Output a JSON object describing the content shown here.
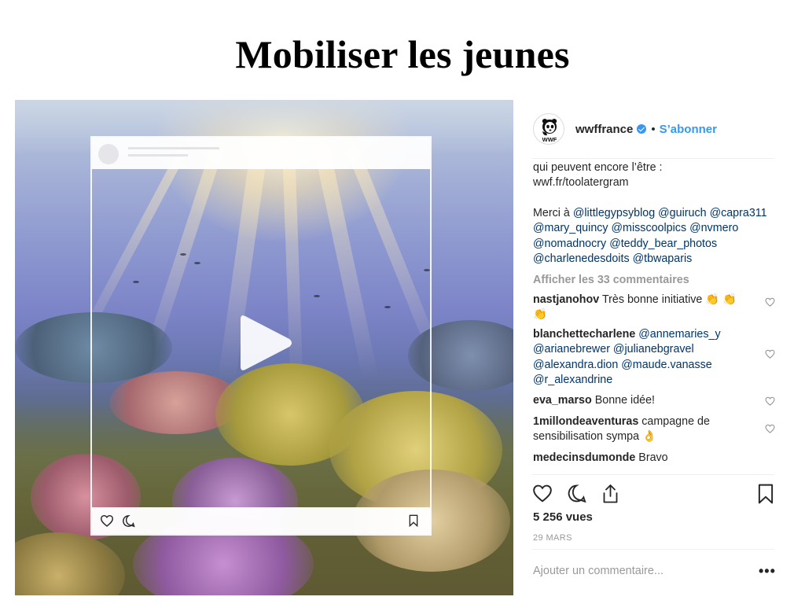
{
  "slide": {
    "title": "Mobiliser les jeunes"
  },
  "post": {
    "account": "wwffrance",
    "logo_text": "WWF",
    "separator": "•",
    "follow_label": "S’abonner",
    "caption_line1": "qui peuvent encore l’être :",
    "caption_link": "wwf.fr/toolatergram",
    "thanks_prefix": "Merci à",
    "mentions": [
      "@littlegypsyblog",
      "@guiruch",
      "@capra311",
      "@mary_quincy",
      "@misscoolpics",
      "@nvmero",
      "@nomadnocry",
      "@teddy_bear_photos",
      "@charlenedesdoits",
      "@tbwaparis"
    ],
    "view_all_comments": "Afficher les 33 commentaires",
    "comments": [
      {
        "user": "nastjanohov",
        "text": "Très bonne initiative 👏 👏 👏"
      },
      {
        "user": "blanchettecharlene",
        "text": "@annemaries_y @arianebrewer @julianebgravel @alexandra.dion @maude.vanasse @r_alexandrine"
      },
      {
        "user": "eva_marso",
        "text": "Bonne idée!"
      },
      {
        "user": "1millondeaventuras",
        "text": "campagne de sensibilisation sympa 👌"
      },
      {
        "user": "medecinsdumonde",
        "text": "Bravo"
      }
    ],
    "views": "5 256 vues",
    "date": "29 MARS",
    "add_comment_placeholder": "Ajouter un commentaire...",
    "more_label": "•••"
  },
  "colors": {
    "link": "#003569",
    "accent": "#3897f0",
    "muted": "#999999"
  },
  "icons": [
    "play-icon",
    "heart-icon",
    "comment-icon",
    "share-icon",
    "bookmark-icon",
    "verified-badge-icon",
    "panda-logo-icon"
  ]
}
